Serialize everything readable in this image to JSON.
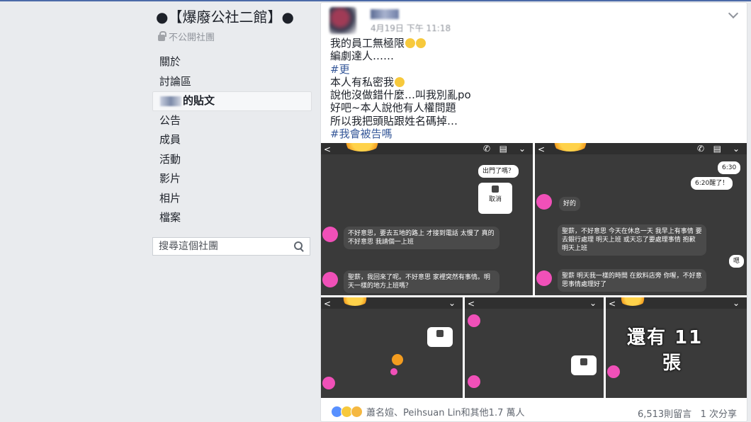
{
  "group": {
    "title": "●【爆廢公社二館】●",
    "privacy": "不公開社團"
  },
  "nav": {
    "items": [
      {
        "label": "關於"
      },
      {
        "label": "討論區"
      },
      {
        "label": "的貼文"
      },
      {
        "label": "公告"
      },
      {
        "label": "成員"
      },
      {
        "label": "活動"
      },
      {
        "label": "影片"
      },
      {
        "label": "相片"
      },
      {
        "label": "檔案"
      }
    ]
  },
  "search": {
    "placeholder": "搜尋這個社團"
  },
  "post": {
    "date": "4月19日 下午 11:18",
    "lines": [
      "我的員工無極限",
      "編劇達人……",
      "#更",
      "本人有私密我",
      "說他沒做錯什麼…叫我別亂po",
      "好吧~本人說他有人權問題",
      "所以我把頭貼跟姓名碼掉…",
      "#我會被告嗎"
    ],
    "shots": {
      "s1": {
        "out_q": "出門了嗎？",
        "cancel": "取消",
        "msg1": "不好意思，要去五地的路上 才接到電話 太慢了 真的不好意思 我請個一上班",
        "msg2": "聖薪，我回來了呢。不好意思 家裡突然有事情。明天一樣的地方上班嗎？"
      },
      "s2": {
        "t1": "6:30",
        "t2": "6:20醒了！",
        "ok": "好的",
        "msg1": "聖薪，不好意思 今天在休息一天 我早上有事情 要去銀行處理 明天上班 或天忘了要處理事情 抱歉 明天上班",
        "reply": "嗯",
        "msg2": "聖薪 明天我一樣的時間 在飲料店旁 你喔，不好意思事情處理好了"
      },
      "s5": {
        "overlay_line1": "還有 11",
        "overlay_line2": "張"
      }
    }
  },
  "footer": {
    "reactions_text": "蕭名媗、Peihsuan Lin和其他1.7 萬人",
    "comments": "6,513則留言",
    "shares": "1 次分享"
  },
  "icons": [
    "lock-icon",
    "search-icon",
    "chevron-down-icon",
    "like-reaction-icon",
    "haha-reaction-icon",
    "wow-reaction-icon",
    "phone-icon",
    "back-arrow-icon"
  ]
}
